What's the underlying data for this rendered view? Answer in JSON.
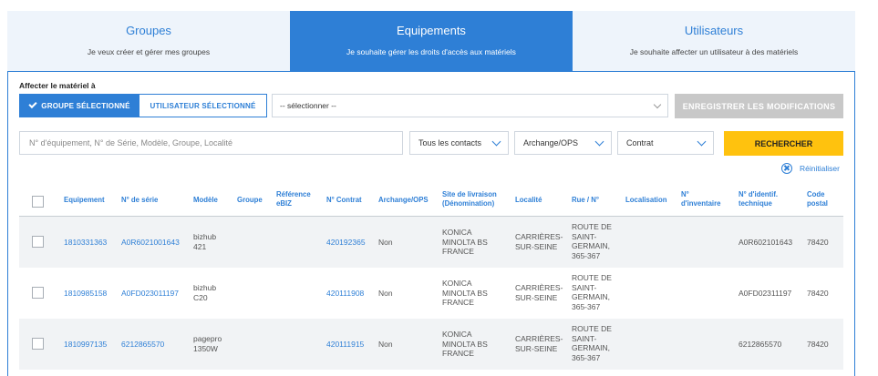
{
  "tabs": [
    {
      "title": "Groupes",
      "subtitle": "Je veux créer et gérer mes groupes",
      "active": false
    },
    {
      "title": "Equipements",
      "subtitle": "Je souhaite gérer les droits d'accès aux matériels",
      "active": true
    },
    {
      "title": "Utilisateurs",
      "subtitle": "Je souhaite affecter un utilisateur à des matériels",
      "active": false
    }
  ],
  "assign": {
    "label": "Affecter le matériel à",
    "group_label": "GROUPE SÉLECTIONNÉ",
    "user_label": "UTILISATEUR SÉLECTIONNÉ",
    "select_value": "-- sélectionner --",
    "save_label": "ENREGISTRER LES MODIFICATIONS"
  },
  "filters": {
    "search_placeholder": "N° d'équipement, N° de Série, Modèle, Groupe, Localité",
    "contacts": "Tous les contacts",
    "archange": "Archange/OPS",
    "contrat": "Contrat",
    "search_label": "RECHERCHER",
    "reset_label": "Réinitialiser"
  },
  "colors": {
    "accent": "#2e7fd6",
    "search_button": "#ffc20e",
    "disabled": "#c8c8c8"
  },
  "table": {
    "headers": {
      "equipement": "Equipement",
      "serie": "N° de série",
      "modele": "Modèle",
      "groupe": "Groupe",
      "ref_ebiz_1": "Référence",
      "ref_ebiz_2": "eBIZ",
      "contrat": "N° Contrat",
      "archange": "Archange/OPS",
      "site_1": "Site de livraison",
      "site_2": "(Dénomination)",
      "localite": "Localité",
      "rue": "Rue / N°",
      "localisation": "Localisation",
      "inventaire_1": "N°",
      "inventaire_2": "d'inventaire",
      "ident_1": "N° d'identif.",
      "ident_2": "technique",
      "cp_1": "Code",
      "cp_2": "postal"
    },
    "rows": [
      {
        "equipement": "1810331363",
        "serie": "A0R6021001643",
        "modele_1": "bizhub",
        "modele_2": "421",
        "contrat": "420192365",
        "archange": "Non",
        "site_1": "KONICA",
        "site_2": "MINOLTA BS",
        "site_3": "FRANCE",
        "localite_1": "CARRIÈRES-",
        "localite_2": "SUR-SEINE",
        "rue_1": "ROUTE DE",
        "rue_2": "SAINT-",
        "rue_3": "GERMAIN,",
        "rue_4": "365-367",
        "ident": "A0R602101643",
        "cp": "78420"
      },
      {
        "equipement": "1810985158",
        "serie": "A0FD023011197",
        "modele_1": "bizhub",
        "modele_2": "C20",
        "contrat": "420111908",
        "archange": "Non",
        "site_1": "KONICA",
        "site_2": "MINOLTA BS",
        "site_3": "FRANCE",
        "localite_1": "CARRIÈRES-",
        "localite_2": "SUR-SEINE",
        "rue_1": "ROUTE DE",
        "rue_2": "SAINT-",
        "rue_3": "GERMAIN,",
        "rue_4": "365-367",
        "ident": "A0FD02311197",
        "cp": "78420"
      },
      {
        "equipement": "1810997135",
        "serie": "6212865570",
        "modele_1": "pagepro",
        "modele_2": "1350W",
        "contrat": "420111915",
        "archange": "Non",
        "site_1": "KONICA",
        "site_2": "MINOLTA BS",
        "site_3": "FRANCE",
        "localite_1": "CARRIÈRES-",
        "localite_2": "SUR-SEINE",
        "rue_1": "ROUTE DE",
        "rue_2": "SAINT-",
        "rue_3": "GERMAIN,",
        "rue_4": "365-367",
        "ident": "6212865570",
        "cp": "78420"
      }
    ]
  }
}
